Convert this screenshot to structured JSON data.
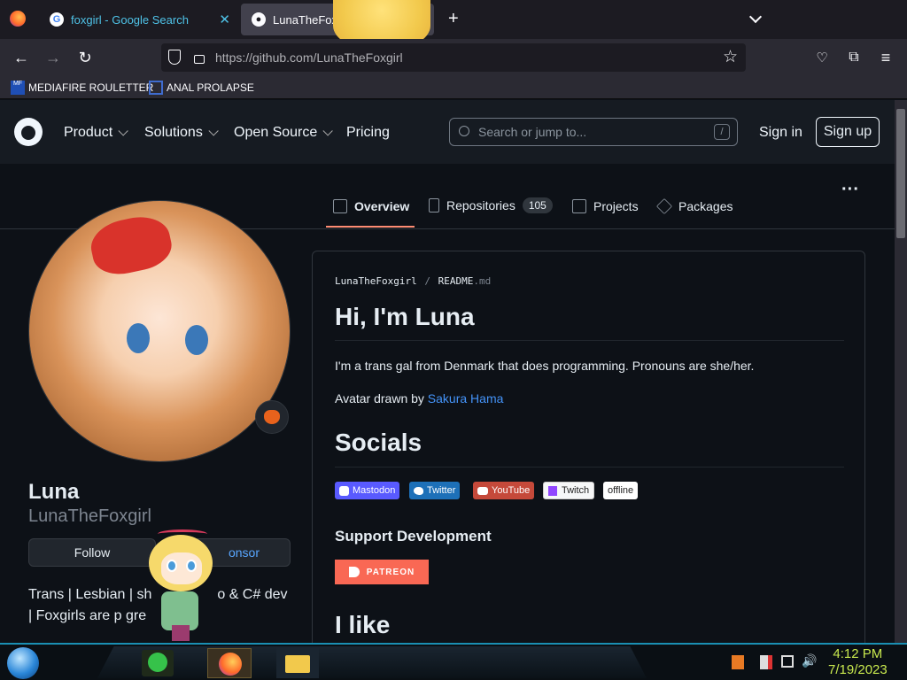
{
  "browser": {
    "tabs": [
      {
        "title": "foxgirl - Google Search",
        "active": false
      },
      {
        "title": "LunaTheFox",
        "active": true
      }
    ],
    "new_tab": "+",
    "url": "https://github.com/LunaTheFoxgirl",
    "bookmarks": [
      "MEDIAFIRE ROULETTER",
      "ANAL PROLAPSE"
    ]
  },
  "github": {
    "nav": [
      "Product",
      "Solutions",
      "Open Source",
      "Pricing"
    ],
    "search_placeholder": "Search or jump to...",
    "search_shortcut": "/",
    "signin": "Sign in",
    "signup": "Sign up"
  },
  "profile_nav": {
    "tabs": [
      {
        "label": "Overview"
      },
      {
        "label": "Repositories",
        "count": "105"
      },
      {
        "label": "Projects"
      },
      {
        "label": "Packages"
      }
    ],
    "more": "···"
  },
  "profile": {
    "name": "Luna",
    "login": "LunaTheFoxgirl",
    "follow": "Follow",
    "sponsor": "onsor",
    "bio_line1": "Trans | Lesbian | sh",
    "bio_line1_end": "o & C# dev",
    "bio_line2": "| Foxgirls are p gre"
  },
  "readme": {
    "path_user": "LunaTheFoxgirl",
    "path_sep": "/",
    "path_file": "README",
    "path_ext": ".md",
    "h1": "Hi, I'm Luna",
    "intro": "I'm a trans gal from Denmark that does programming. Pronouns are she/her.",
    "avatar_prefix": "Avatar drawn by ",
    "avatar_artist": "Sakura Hama",
    "socials": "Socials",
    "shields": [
      {
        "label": "Mastodon",
        "color": "#6364ff"
      },
      {
        "label": "Twitter",
        "color": "#1d9bf0"
      },
      {
        "label": "YouTube",
        "color": "#e05d44"
      },
      {
        "label": "Twitch",
        "color": "#ffffff"
      },
      {
        "label": "offline",
        "color": "#ffffff"
      }
    ],
    "support": "Support Development",
    "patreon": "PATREON",
    "like": "I like"
  },
  "taskbar": {
    "time": "4:12 PM",
    "date": "7/19/2023"
  }
}
